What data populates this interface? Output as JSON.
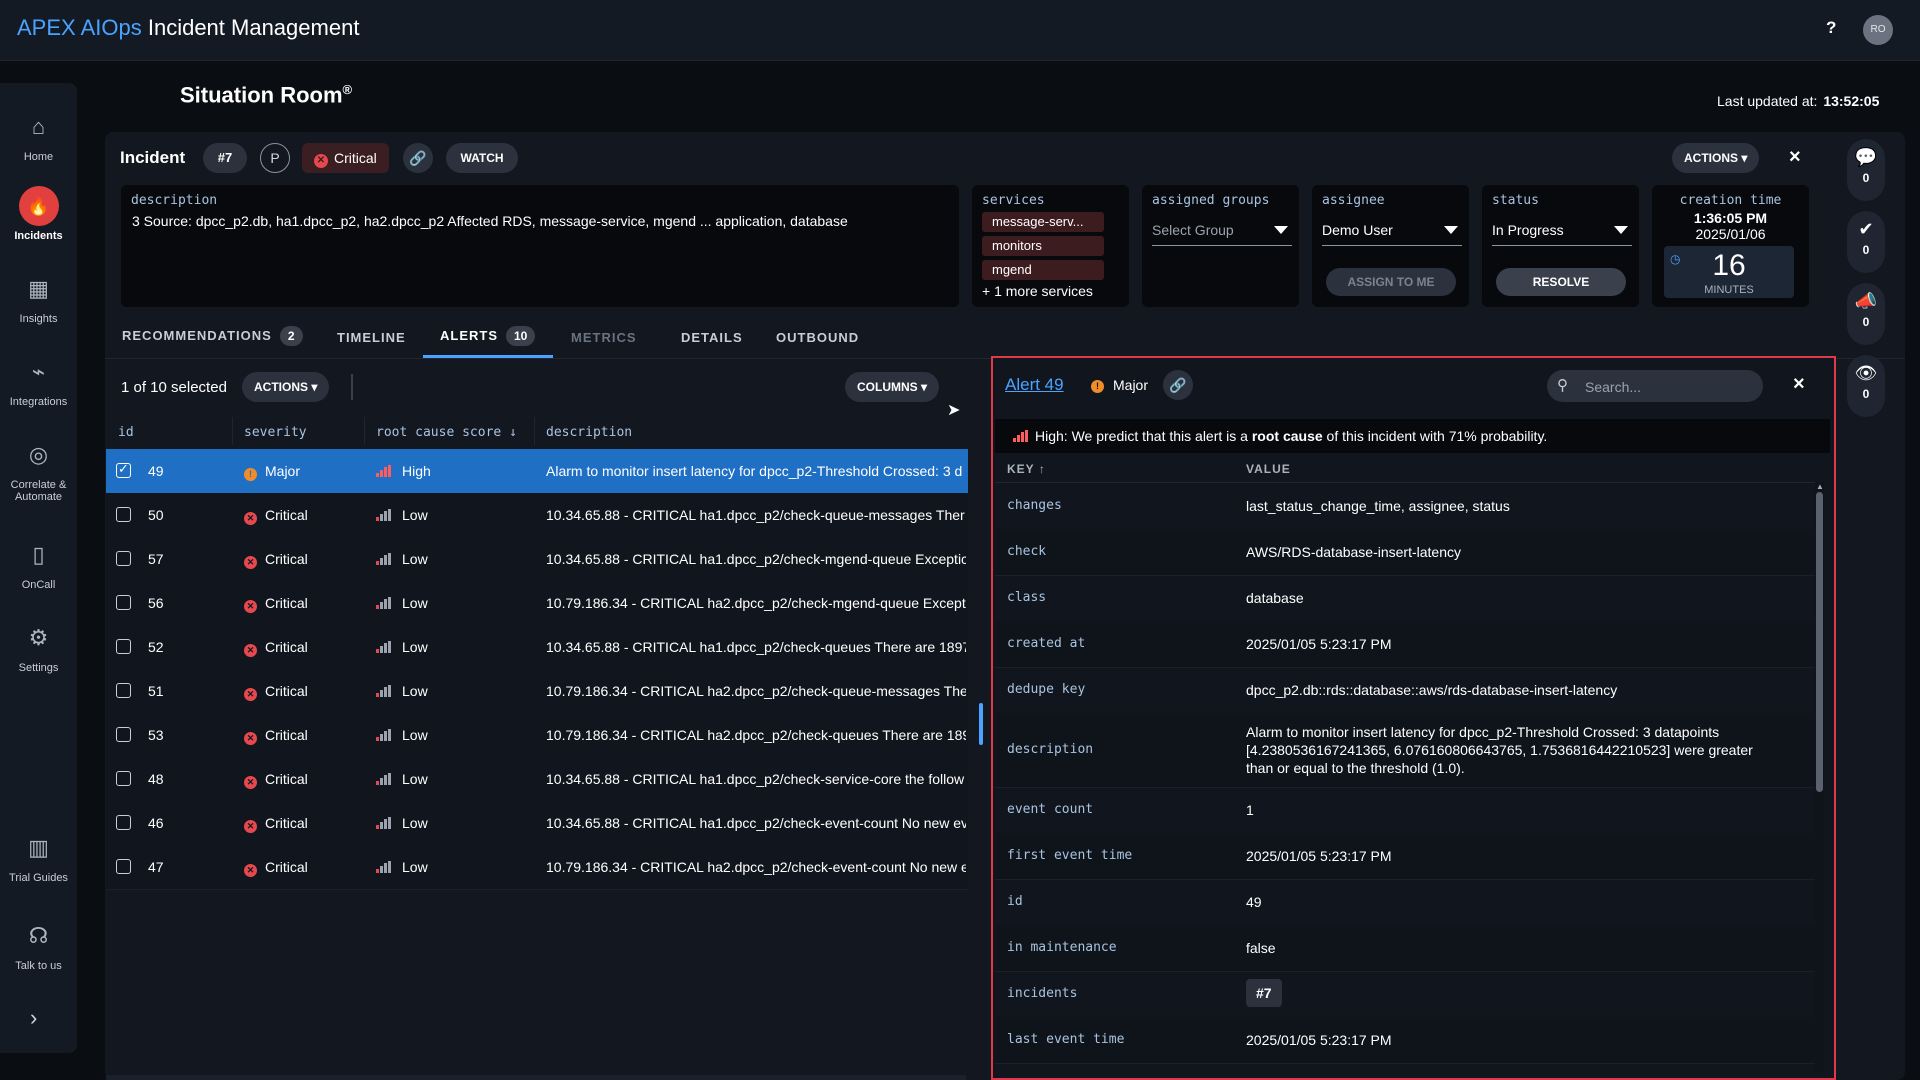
{
  "app": {
    "brand": "APEX AIOps",
    "title": " Incident Management",
    "help": "?",
    "user_initials": "RO"
  },
  "nav": {
    "items": [
      {
        "label": "Home",
        "icon": "home-icon"
      },
      {
        "label": "Incidents",
        "icon": "flame-icon"
      },
      {
        "label": "Insights",
        "icon": "grid-icon"
      },
      {
        "label": "Integrations",
        "icon": "plug-icon"
      },
      {
        "label": "Correlate & Automate",
        "icon": "target-icon"
      },
      {
        "label": "OnCall",
        "icon": "phone-icon"
      },
      {
        "label": "Settings",
        "icon": "gear-icon"
      },
      {
        "label": "Trial Guides",
        "icon": "books-icon"
      },
      {
        "label": "Talk to us",
        "icon": "headset-icon"
      }
    ],
    "active": "Incidents",
    "expand": "›"
  },
  "header": {
    "title": "Situation Room",
    "title_mark": "®",
    "updated_label": "Last updated at:",
    "updated_time": "13:52:05"
  },
  "incident": {
    "label": "Incident",
    "number": "#7",
    "priority": "P",
    "severity": "Critical",
    "watch": "WATCH",
    "actions": "ACTIONS",
    "description_label": "description",
    "description": "3 Source: dpcc_p2.db, ha1.dpcc_p2, ha2.dpcc_p2 Affected RDS, message-service, mgend ... application, database",
    "services_label": "services",
    "services": [
      "message-serv...",
      "monitors",
      "mgend"
    ],
    "services_more": "+ 1 more services",
    "groups_label": "assigned groups",
    "groups_placeholder": "Select Group",
    "assignee_label": "assignee",
    "assignee": "Demo User",
    "assign_to_me": "ASSIGN TO ME",
    "status_label": "status",
    "status": "In Progress",
    "resolve": "RESOLVE",
    "creation_label": "creation time",
    "creation_time": "1:36:05 PM",
    "creation_date": "2025/01/06",
    "elapsed_value": "16",
    "elapsed_unit": "MINUTES"
  },
  "rail": [
    {
      "icon": "chat-icon",
      "count": "0"
    },
    {
      "icon": "check-badge-icon",
      "count": "0"
    },
    {
      "icon": "megaphone-icon",
      "count": "0"
    },
    {
      "icon": "eye-icon",
      "count": "0"
    }
  ],
  "tabs": [
    {
      "label": "RECOMMENDATIONS",
      "badge": "2"
    },
    {
      "label": "TIMELINE"
    },
    {
      "label": "ALERTS",
      "badge": "10"
    },
    {
      "label": "METRICS"
    },
    {
      "label": "DETAILS"
    },
    {
      "label": "OUTBOUND"
    }
  ],
  "active_tab": "ALERTS",
  "alerts": {
    "selected_text": "1 of 10 selected",
    "actions": "ACTIONS",
    "columns": "COLUMNS",
    "headers": {
      "id": "id",
      "severity": "severity",
      "root_cause": "root cause score",
      "description": "description"
    },
    "rows": [
      {
        "id": "49",
        "severity": "Major",
        "score": "High",
        "description": "Alarm to monitor insert latency for dpcc_p2-Threshold Crossed: 3 d",
        "selected": true
      },
      {
        "id": "50",
        "severity": "Critical",
        "score": "Low",
        "description": "10.34.65.88 - CRITICAL ha1.dpcc_p2/check-queue-messages Ther"
      },
      {
        "id": "57",
        "severity": "Critical",
        "score": "Low",
        "description": "10.34.65.88 - CRITICAL ha1.dpcc_p2/check-mgend-queue Exceptic"
      },
      {
        "id": "56",
        "severity": "Critical",
        "score": "Low",
        "description": "10.79.186.34 - CRITICAL ha2.dpcc_p2/check-mgend-queue Except"
      },
      {
        "id": "52",
        "severity": "Critical",
        "score": "Low",
        "description": "10.34.65.88 - CRITICAL ha1.dpcc_p2/check-queues There are 1897"
      },
      {
        "id": "51",
        "severity": "Critical",
        "score": "Low",
        "description": "10.79.186.34 - CRITICAL ha2.dpcc_p2/check-queue-messages The"
      },
      {
        "id": "53",
        "severity": "Critical",
        "score": "Low",
        "description": "10.79.186.34 - CRITICAL ha2.dpcc_p2/check-queues There are 189"
      },
      {
        "id": "48",
        "severity": "Critical",
        "score": "Low",
        "description": "10.34.65.88 - CRITICAL ha1.dpcc_p2/check-service-core the follow"
      },
      {
        "id": "46",
        "severity": "Critical",
        "score": "Low",
        "description": "10.34.65.88 - CRITICAL ha1.dpcc_p2/check-event-count No new ev"
      },
      {
        "id": "47",
        "severity": "Critical",
        "score": "Low",
        "description": "10.79.186.34 - CRITICAL ha2.dpcc_p2/check-event-count No new e"
      }
    ]
  },
  "detail": {
    "title": "Alert 49",
    "severity": "Major",
    "search_placeholder": "Search...",
    "prediction_pre": "High: We predict that this alert is a ",
    "prediction_bold": "root cause",
    "prediction_post": " of this incident with 71% probability.",
    "key_header": "KEY",
    "sort_arrow": "↑",
    "value_header": "VALUE",
    "rows": [
      {
        "key": "changes",
        "value": "last_status_change_time, assignee, status"
      },
      {
        "key": "check",
        "value": "AWS/RDS-database-insert-latency"
      },
      {
        "key": "class",
        "value": "database"
      },
      {
        "key": "created at",
        "value": "2025/01/05 5:23:17 PM"
      },
      {
        "key": "dedupe key",
        "value": "dpcc_p2.db::rds::database::aws/rds-database-insert-latency"
      },
      {
        "key": "description",
        "value": "Alarm to monitor insert latency for dpcc_p2-Threshold Crossed: 3 datapoints [4.2380536167241365, 6.076160806643765, 1.7536816442210523] were greater than or equal to the threshold (1.0)."
      },
      {
        "key": "event count",
        "value": "1"
      },
      {
        "key": "first event time",
        "value": "2025/01/05 5:23:17 PM"
      },
      {
        "key": "id",
        "value": "49"
      },
      {
        "key": "in maintenance",
        "value": "false"
      },
      {
        "key": "incidents",
        "value": "#7"
      },
      {
        "key": "last event time",
        "value": "2025/01/05 5:23:17 PM"
      }
    ]
  },
  "colors": {
    "accent": "#4aa3ff",
    "critical": "#e5484d",
    "major": "#f28c28",
    "selected_row": "#1f6fc5",
    "highlight_border": "#e0394a"
  }
}
